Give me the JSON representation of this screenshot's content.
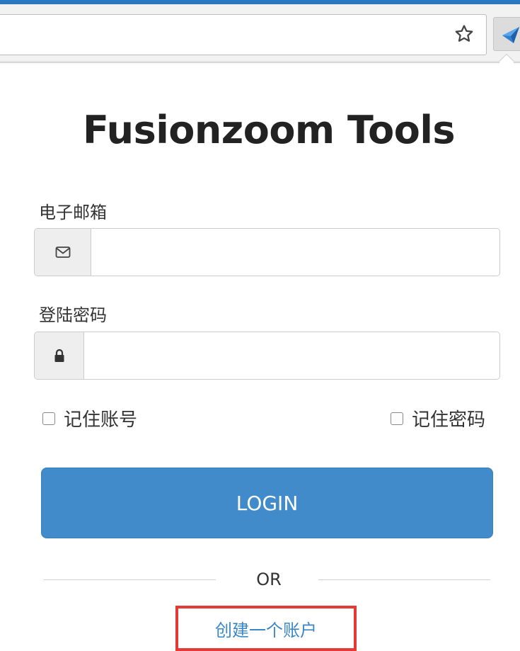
{
  "browser": {
    "star_icon": "star-outline-icon",
    "extension_icon": "fusionzoom-extension-icon"
  },
  "popup": {
    "title": "Fusionzoom Tools",
    "email": {
      "label": "电子邮箱",
      "icon": "envelope-icon",
      "value": "",
      "placeholder": ""
    },
    "password": {
      "label": "登陆密码",
      "icon": "lock-icon",
      "value": "",
      "placeholder": ""
    },
    "remember_account": {
      "label": "记住账号",
      "checked": false
    },
    "remember_password": {
      "label": "记住密码",
      "checked": false
    },
    "login_button": "LOGIN",
    "or_text": "OR",
    "create_account_link": "创建一个账户"
  },
  "colors": {
    "accent": "#428bca",
    "link": "#3a87c8",
    "highlight_border": "#e53935"
  }
}
